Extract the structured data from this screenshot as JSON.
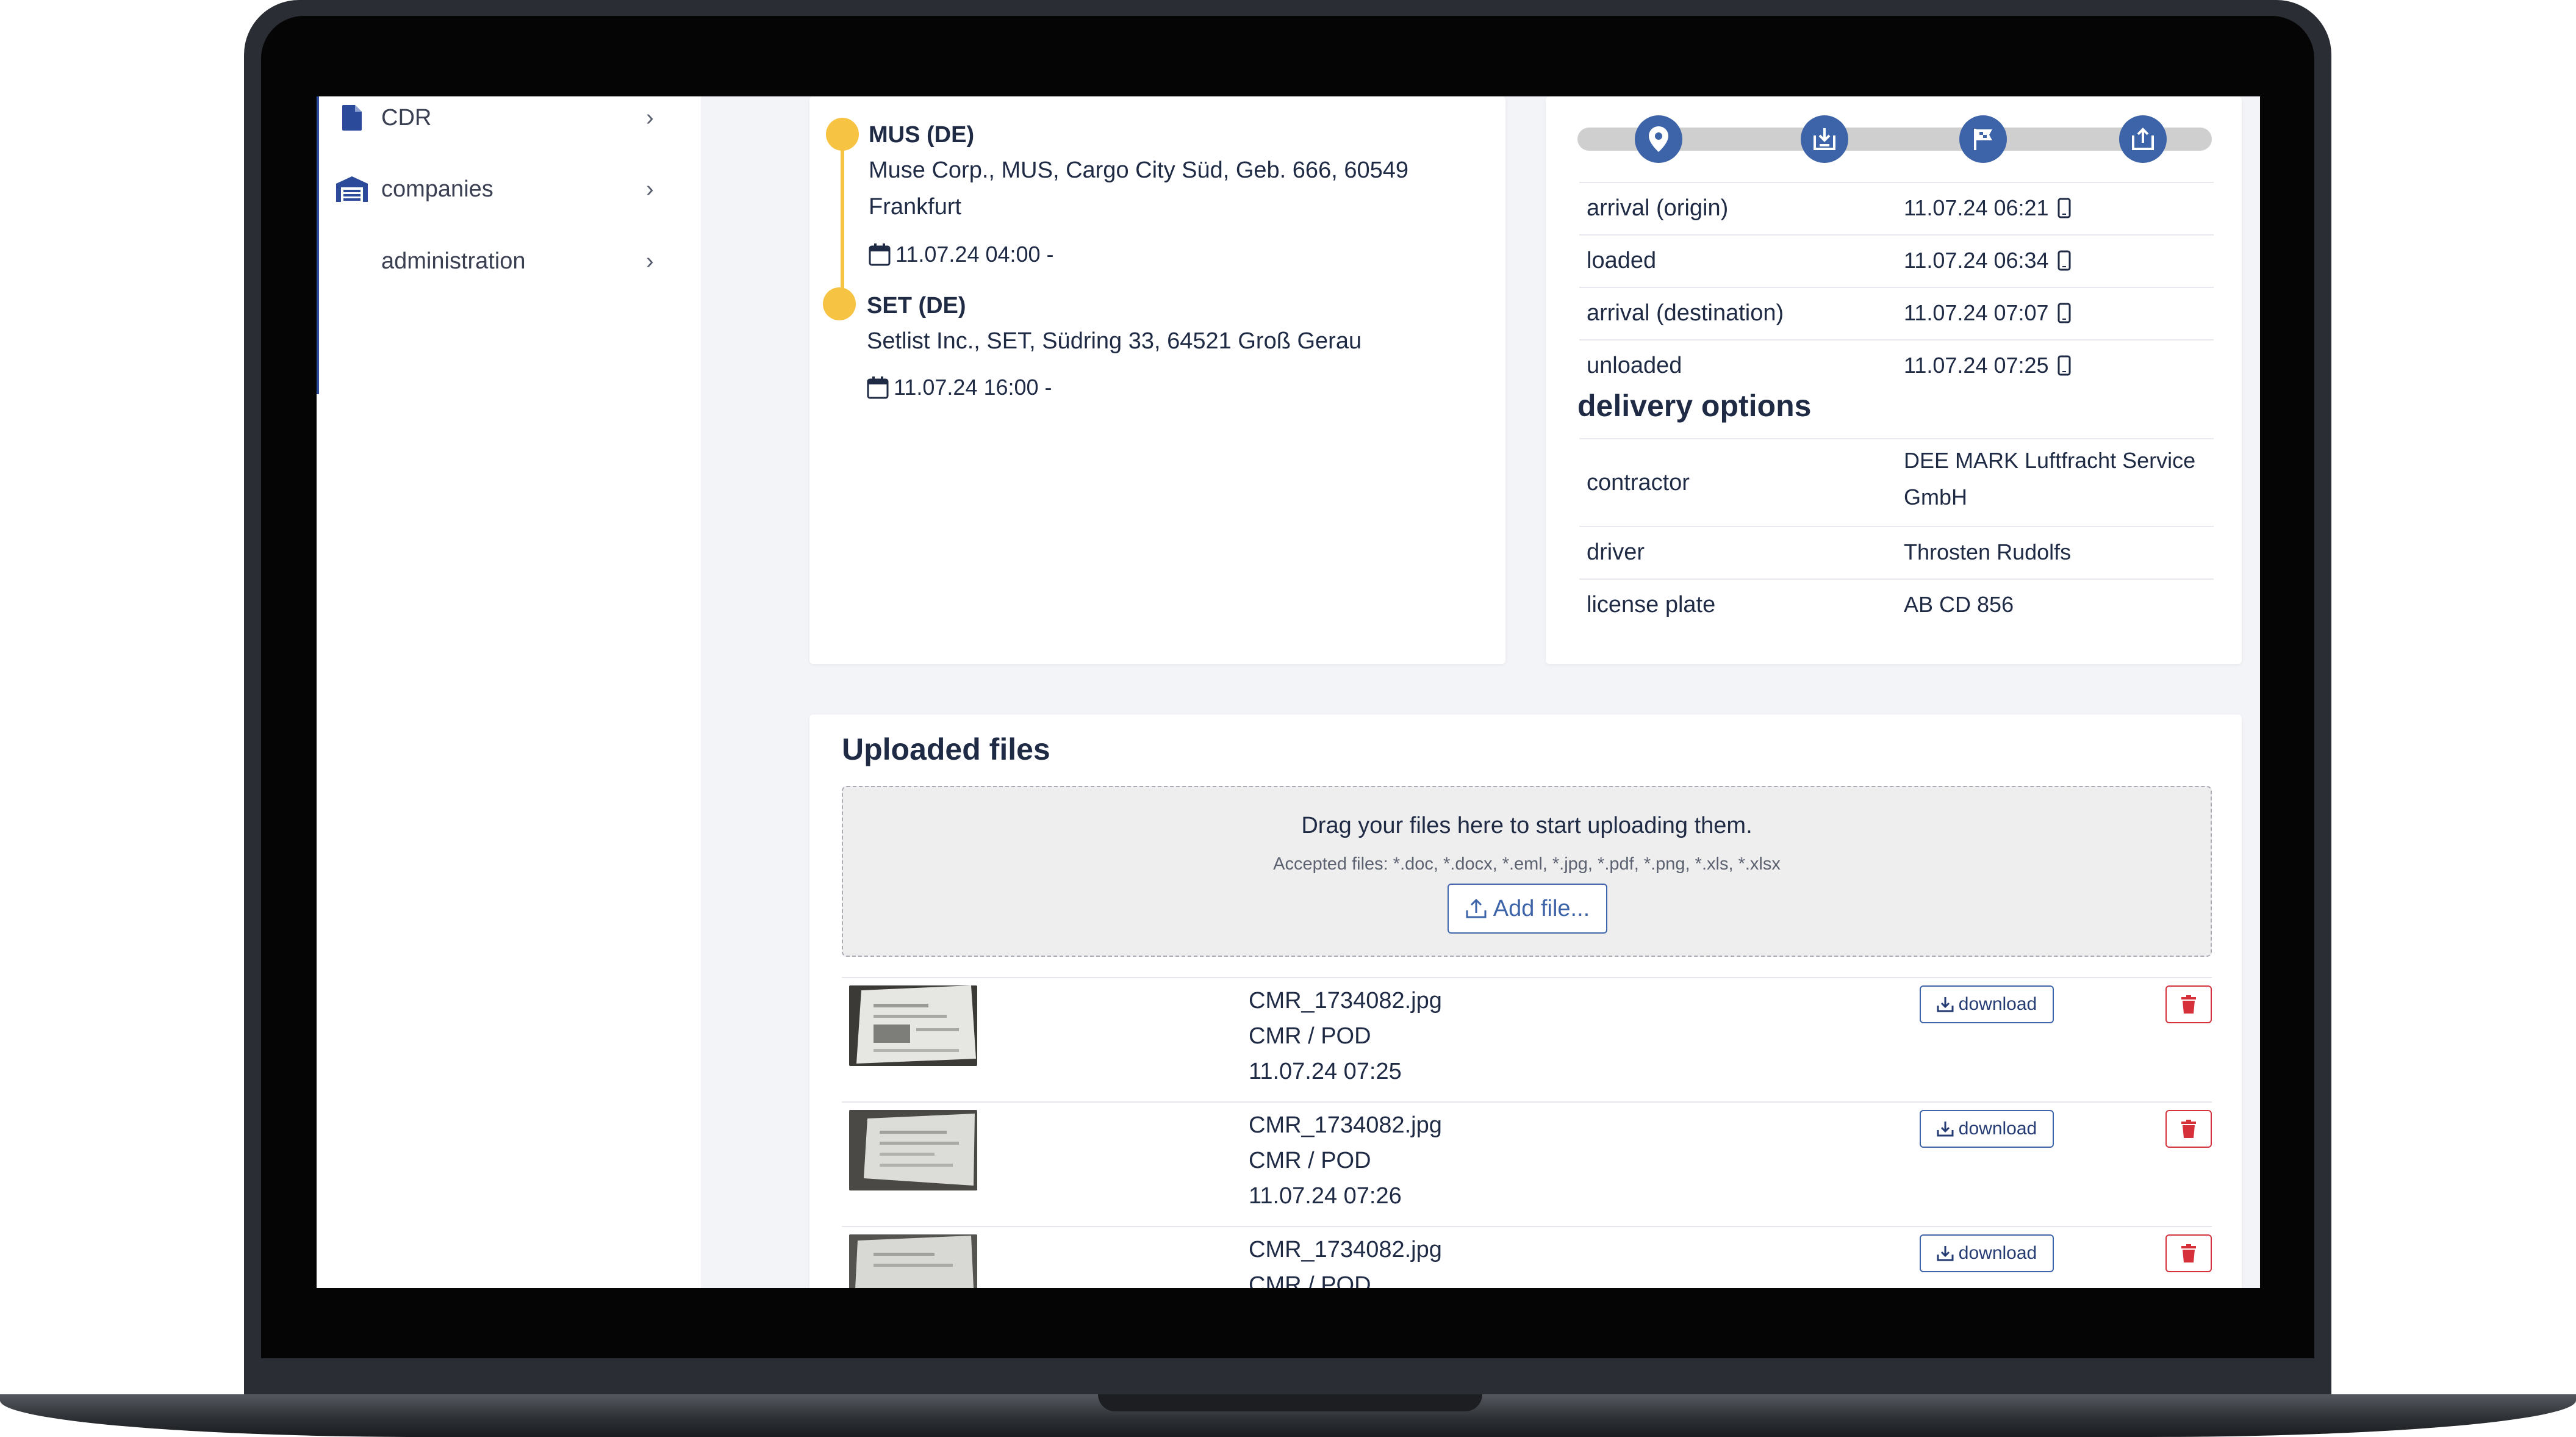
{
  "sidebar": {
    "items": [
      {
        "label": "CDR",
        "icon": "document-icon"
      },
      {
        "label": "companies",
        "icon": "warehouse-icon"
      },
      {
        "label": "administration",
        "icon": ""
      }
    ]
  },
  "route": {
    "stops": [
      {
        "code": "MUS (DE)",
        "address_line1": "Muse Corp., MUS, Cargo City Süd, Geb. 666, 60549",
        "address_line2": "Frankfurt",
        "date": "11.07.24 04:00 -"
      },
      {
        "code": "SET (DE)",
        "address_line1": "Setlist Inc., SET, Südring 33, 64521 Groß Gerau",
        "address_line2": "",
        "date": "11.07.24 16:00 -"
      }
    ]
  },
  "status": {
    "steps": [
      "map-pin-icon",
      "load-icon",
      "finish-flag-icon",
      "unload-icon"
    ],
    "rows": [
      {
        "label": "arrival (origin)",
        "value": "11.07.24 06:21"
      },
      {
        "label": "loaded",
        "value": "11.07.24 06:34"
      },
      {
        "label": "arrival (destination)",
        "value": "11.07.24 07:07"
      },
      {
        "label": "unloaded",
        "value": "11.07.24 07:25"
      }
    ]
  },
  "delivery": {
    "title": "delivery options",
    "contractor_label": "contractor",
    "contractor_line1": "DEE MARK Luftfracht Service",
    "contractor_line2": "GmbH",
    "driver_label": "driver",
    "driver": "Throsten Rudolfs",
    "plate_label": "license plate",
    "plate": "AB CD 856"
  },
  "uploads": {
    "title": "Uploaded files",
    "drop_text": "Drag your files here to start uploading them.",
    "accepted": "Accepted files: *.doc, *.docx, *.eml, *.jpg, *.pdf, *.png, *.xls, *.xlsx",
    "add_label": "Add file...",
    "download_label": "download",
    "files": [
      {
        "name": "CMR_1734082.jpg",
        "type": "CMR / POD",
        "date": "11.07.24 07:25"
      },
      {
        "name": "CMR_1734082.jpg",
        "type": "CMR / POD",
        "date": "11.07.24 07:26"
      },
      {
        "name": "CMR_1734082.jpg",
        "type": "CMR / POD",
        "date": ""
      }
    ]
  },
  "colors": {
    "accent": "#3d63a8",
    "stop": "#f7c342",
    "danger": "#d6303a"
  }
}
